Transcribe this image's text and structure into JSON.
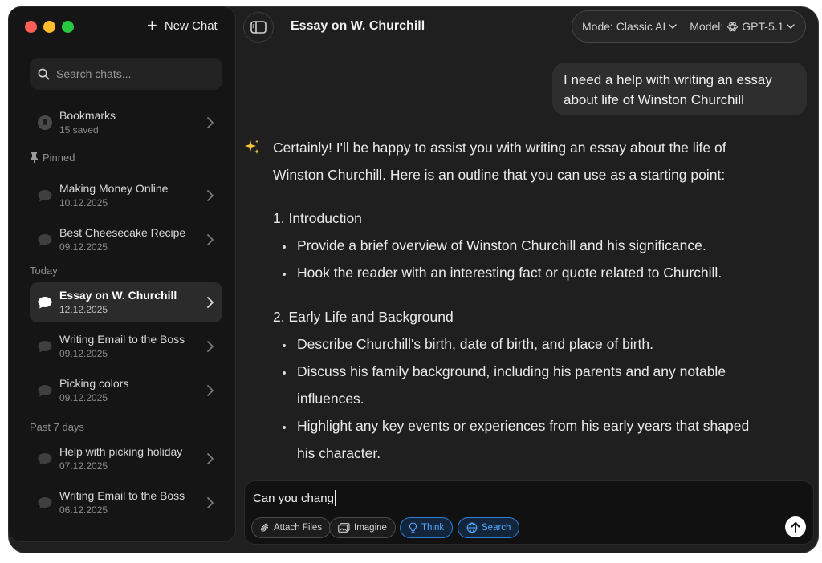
{
  "sidebar": {
    "new_chat_label": "New Chat",
    "search_placeholder": "Search chats...",
    "bookmarks": {
      "title": "Bookmarks",
      "subtitle": "15 saved"
    },
    "pinned_label": "Pinned",
    "pinned": [
      {
        "title": "Making Money Online",
        "date": "10.12.2025"
      },
      {
        "title": "Best Cheesecake Recipe",
        "date": "09.12.2025"
      }
    ],
    "today_label": "Today",
    "today": [
      {
        "title": "Essay on W. Churchill",
        "date": "12.12.2025",
        "active": true
      },
      {
        "title": "Writing Email to the Boss",
        "date": "09.12.2025"
      },
      {
        "title": "Picking colors",
        "date": "09.12.2025"
      }
    ],
    "past_label": "Past 7 days",
    "past": [
      {
        "title": "Help with picking holiday",
        "date": "07.12.2025"
      },
      {
        "title": "Writing Email to the Boss",
        "date": "06.12.2025"
      }
    ]
  },
  "header": {
    "title": "Essay on W. Churchill",
    "mode": "Mode: Classic AI",
    "model_label": "Model:",
    "model": "GPT-5.1"
  },
  "chat": {
    "user_message_line1": "I need a help with writing an essay",
    "user_message_line2": "about life of Winston Churchill",
    "answer": {
      "intro_line1": "Certainly! I'll be happy to assist you with writing an essay about the life of",
      "intro_line2": "Winston Churchill. Here is an outline that you can use as a starting point:",
      "section1": "1. Introduction",
      "s1_b1": "Provide a brief overview of Winston Churchill and his significance.",
      "s1_b2": "Hook the reader with an interesting fact or quote related to Churchill.",
      "section2": "2. Early Life and Background",
      "s2_b1": "Describe Churchill's birth, date of birth, and place of birth.",
      "s2_b2_line1": "Discuss his family background, including his parents and any notable",
      "s2_b2_line2": "influences.",
      "s2_b3_line1": "Highlight any key events or experiences from his early years that shaped",
      "s2_b3_line2": "his character."
    }
  },
  "composer": {
    "text": "Can you chang",
    "attach_label": "Attach Files",
    "imagine_label": "Imagine",
    "think_label": "Think",
    "search_label": "Search"
  },
  "colors": {
    "accent_blue": "#2f7fd8",
    "traffic_red": "#fe5f57",
    "traffic_yellow": "#febc2e",
    "traffic_green": "#28c840"
  }
}
